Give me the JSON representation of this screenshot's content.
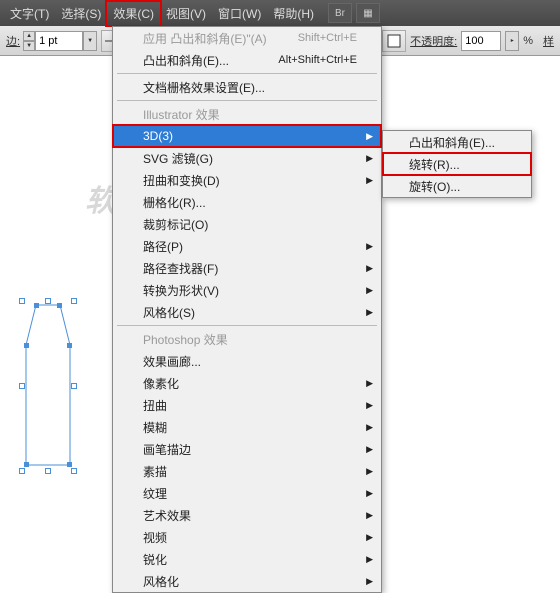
{
  "menubar": {
    "items": [
      "文字(T)",
      "选择(S)",
      "效果(C)",
      "视图(V)",
      "窗口(W)",
      "帮助(H)"
    ],
    "br_label": "Br"
  },
  "toolbar": {
    "stroke_label": "边:",
    "stroke_value": "1 pt",
    "opacity_label": "不透明度:",
    "opacity_value": "100",
    "percent": "%"
  },
  "watermark": "软件自学网",
  "menu": {
    "apply": "应用",
    "apply_item": "凸出和斜角(E)\"(A)",
    "apply_shortcut": "Shift+Ctrl+E",
    "last": "凸出和斜角(E)...",
    "last_shortcut": "Alt+Shift+Ctrl+E",
    "raster_settings": "文档栅格效果设置(E)...",
    "section_ai": "Illustrator 效果",
    "items_ai": [
      {
        "label": "3D(3)",
        "arrow": true,
        "selected": true,
        "boxed": true
      },
      {
        "label": "SVG 滤镜(G)",
        "arrow": true
      },
      {
        "label": "扭曲和变换(D)",
        "arrow": true
      },
      {
        "label": "栅格化(R)..."
      },
      {
        "label": "裁剪标记(O)"
      },
      {
        "label": "路径(P)",
        "arrow": true
      },
      {
        "label": "路径查找器(F)",
        "arrow": true
      },
      {
        "label": "转换为形状(V)",
        "arrow": true
      },
      {
        "label": "风格化(S)",
        "arrow": true
      }
    ],
    "section_ps": "Photoshop 效果",
    "items_ps": [
      {
        "label": "效果画廊..."
      },
      {
        "label": "像素化",
        "arrow": true
      },
      {
        "label": "扭曲",
        "arrow": true
      },
      {
        "label": "模糊",
        "arrow": true
      },
      {
        "label": "画笔描边",
        "arrow": true
      },
      {
        "label": "素描",
        "arrow": true
      },
      {
        "label": "纹理",
        "arrow": true
      },
      {
        "label": "艺术效果",
        "arrow": true
      },
      {
        "label": "视频",
        "arrow": true
      },
      {
        "label": "锐化",
        "arrow": true
      },
      {
        "label": "风格化",
        "arrow": true
      }
    ]
  },
  "submenu": {
    "items": [
      {
        "label": "凸出和斜角(E)..."
      },
      {
        "label": "绕转(R)...",
        "boxed": true
      },
      {
        "label": "旋转(O)..."
      }
    ]
  }
}
